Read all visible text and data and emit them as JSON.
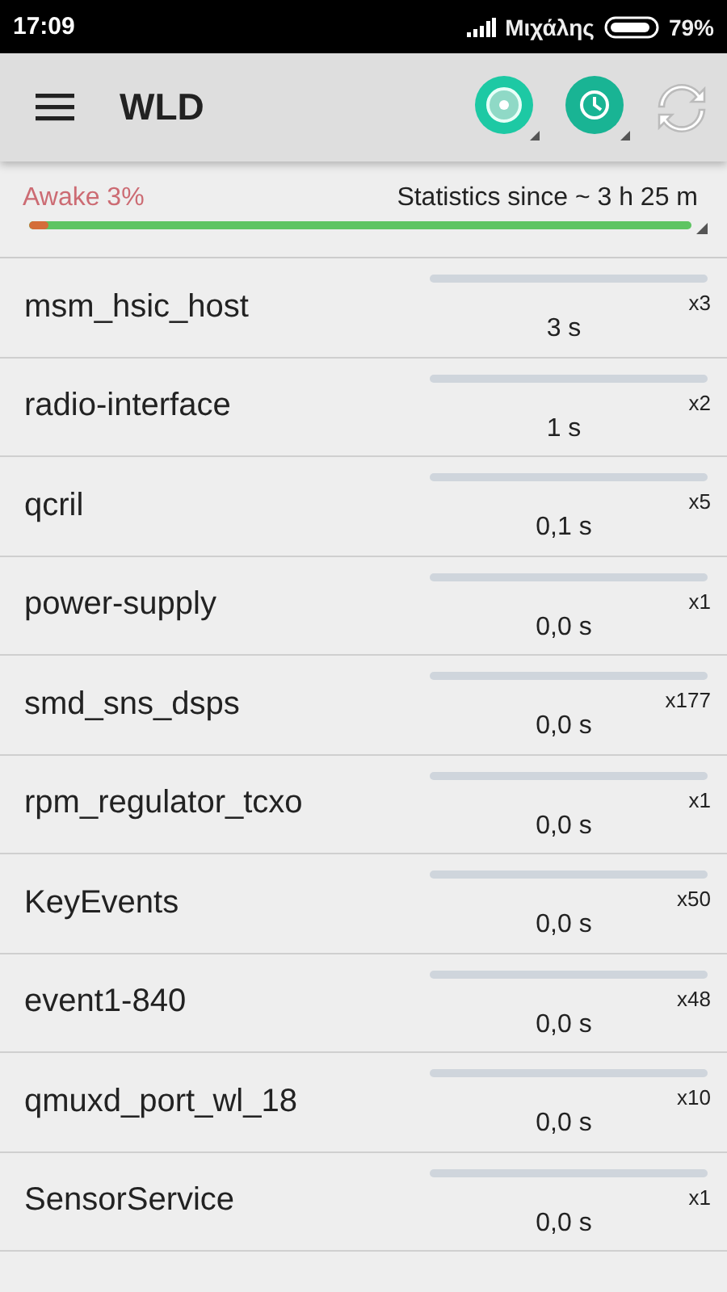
{
  "status_bar": {
    "time": "17:09",
    "carrier": "Μιχάλης",
    "battery": "79%"
  },
  "toolbar": {
    "title": "WLD"
  },
  "summary": {
    "awake": "Awake 3%",
    "since": "Statistics since ~ 3 h 25 m",
    "level": 0.03
  },
  "wakelocks": [
    {
      "name": "msm_hsic_host",
      "count": "x3",
      "time": "3 s",
      "level": 0
    },
    {
      "name": "radio-interface",
      "count": "x2",
      "time": "1 s",
      "level": 0
    },
    {
      "name": "qcril",
      "count": "x5",
      "time": "0,1 s",
      "level": 0
    },
    {
      "name": "power-supply",
      "count": "x1",
      "time": "0,0 s",
      "level": 0
    },
    {
      "name": "smd_sns_dsps",
      "count": "x177",
      "time": "0,0 s",
      "level": 0
    },
    {
      "name": "rpm_regulator_tcxo",
      "count": "x1",
      "time": "0,0 s",
      "level": 0
    },
    {
      "name": "KeyEvents",
      "count": "x50",
      "time": "0,0 s",
      "level": 0
    },
    {
      "name": "event1-840",
      "count": "x48",
      "time": "0,0 s",
      "level": 0
    },
    {
      "name": "qmuxd_port_wl_18",
      "count": "x10",
      "time": "0,0 s",
      "level": 0
    },
    {
      "name": "SensorService",
      "count": "x1",
      "time": "0,0 s",
      "level": 0
    }
  ]
}
